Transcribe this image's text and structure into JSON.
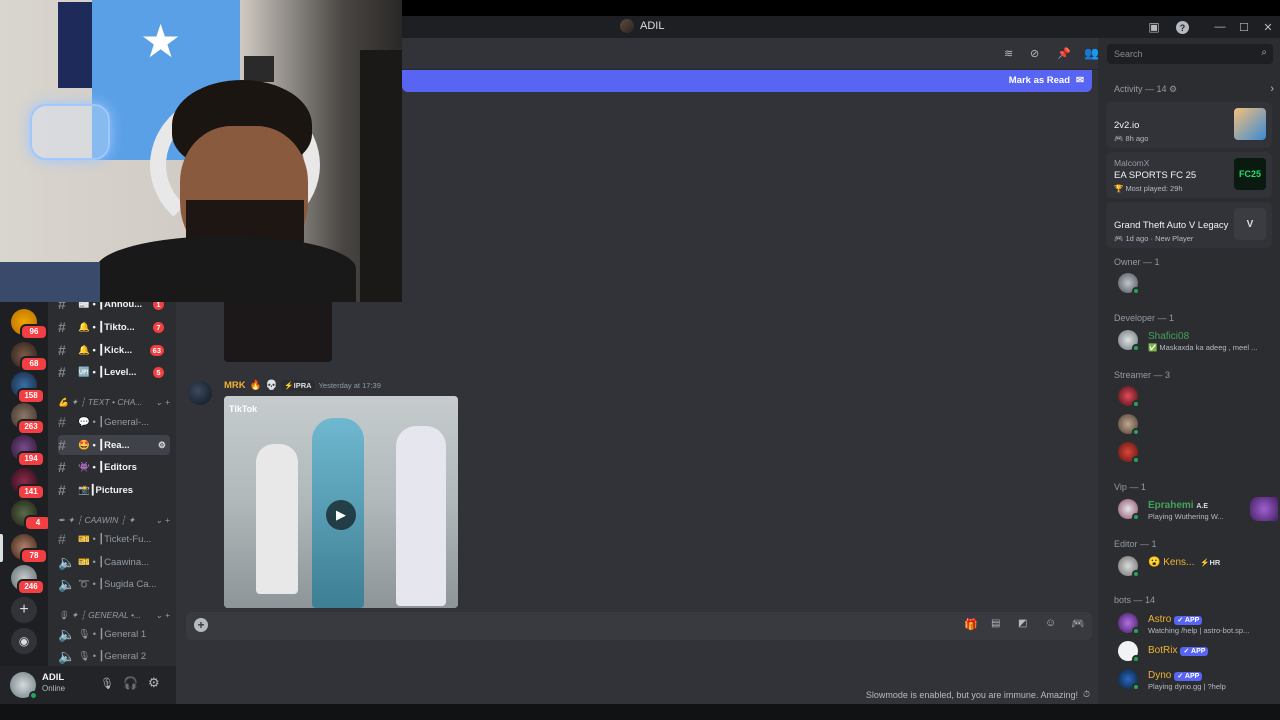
{
  "window": {
    "title": "ADIL"
  },
  "header_icons": [
    "threads-icon",
    "mute-icon",
    "pin-icon",
    "members-icon"
  ],
  "search": {
    "placeholder": "Search"
  },
  "new_messages_bar": {
    "mark_label": "Mark as Read"
  },
  "servers": [
    {
      "badge": "96"
    },
    {
      "badge": "68"
    },
    {
      "badge": "158"
    },
    {
      "badge": "263"
    },
    {
      "badge": "194"
    },
    {
      "badge": "141"
    },
    {
      "badge": "4"
    },
    {
      "badge": "78"
    },
    {
      "badge": "246"
    }
  ],
  "channels": {
    "items": [
      {
        "label": "📰 • ┃Annou...",
        "badge": "1",
        "unread": true
      },
      {
        "label": "🔔 • ┃Tikto...",
        "badge": "7",
        "unread": true
      },
      {
        "label": "🔔 • ┃Kick...",
        "badge": "63",
        "unread": true
      },
      {
        "label": "🆙 • ┃Level...",
        "badge": "5",
        "unread": true
      },
      {
        "label": "💬 • ┃General-...",
        "badge": "",
        "unread": false
      },
      {
        "label": "🤩 • ┃Rea...",
        "badge": "",
        "unread": true
      },
      {
        "label": "👾 • ┃Editors",
        "badge": "",
        "unread": true
      },
      {
        "label": "📸┃Pictures",
        "badge": "",
        "unread": true
      },
      {
        "label": "🎫 • ┃Ticket-Fu...",
        "badge": "",
        "unread": false
      },
      {
        "label": "🎫 • ┃Caawina...",
        "badge": "",
        "unread": false
      },
      {
        "label": "➰ • ┃Sugida Ca...",
        "badge": "",
        "unread": false
      },
      {
        "label": "🎙 • ┃General 1",
        "badge": "",
        "unread": false
      },
      {
        "label": "🎙 • ┃General 2",
        "badge": "",
        "unread": false
      }
    ],
    "categories": [
      "💪 ✦ ┆ TEXT • CHA...",
      "✒ ✦ ┆ CAAWIN ┆ ✦",
      "🎙 ✦ ┆ GENERAL •..."
    ]
  },
  "user_panel": {
    "name": "ADIL",
    "status": "Online"
  },
  "message": {
    "author": "MRK",
    "tag": "IPRA",
    "timestamp": "Yesterday at 17:39",
    "video_source": "TikTok"
  },
  "composer": {
    "placeholder": ""
  },
  "slowmode_text": "Slowmode is enabled, but you are immune. Amazing!",
  "member_list": {
    "activity_title": "Activity — 14",
    "activities": [
      {
        "user": "",
        "game": "2v2.io",
        "detail": "8h ago",
        "thumb_color": "#e8a86a"
      },
      {
        "user": "MalcomX",
        "game": "EA SPORTS FC 25",
        "detail": "Most played: 29h",
        "thumb_color": "#101a12"
      },
      {
        "user": "",
        "game": "Grand Theft Auto V Legacy",
        "detail": "1d ago",
        "extra": "New Player",
        "thumb_color": "#2b2d31"
      }
    ],
    "groups": [
      {
        "title": "Owner — 1",
        "members": [
          {
            "name": "",
            "status": "",
            "color": "#f23f43"
          }
        ]
      },
      {
        "title": "Developer — 1",
        "members": [
          {
            "name": "Shafici08",
            "status": "✅ Maskaxda ka adeeg , meel ...",
            "color": "#43a25a"
          }
        ]
      },
      {
        "title": "Streamer — 3",
        "members": [
          {
            "name": "",
            "status": "",
            "color": "#f23f43"
          },
          {
            "name": "",
            "status": "",
            "color": "#f23f43"
          },
          {
            "name": "",
            "status": "",
            "color": "#f23f43"
          }
        ]
      },
      {
        "title": "Vip — 1",
        "members": [
          {
            "name": "Eprahemi",
            "status": "Playing Wuthering W...",
            "color": "#43a25a",
            "tag": "A.E"
          }
        ]
      },
      {
        "title": "Editor — 1",
        "members": [
          {
            "name": "Kens...",
            "status": "",
            "color": "#f0b232",
            "tag": "HR"
          }
        ]
      },
      {
        "title": "bots — 14",
        "members": [
          {
            "name": "Astro",
            "status": "Watching /help | astro-bot.sp...",
            "color": "#f0b232",
            "app": "APP"
          },
          {
            "name": "BotRix",
            "status": "",
            "color": "#f0b232",
            "app": "APP"
          },
          {
            "name": "Dyno",
            "status": "Playing dyno.gg | ?help",
            "color": "#f0b232",
            "app": "APP"
          }
        ]
      }
    ]
  }
}
